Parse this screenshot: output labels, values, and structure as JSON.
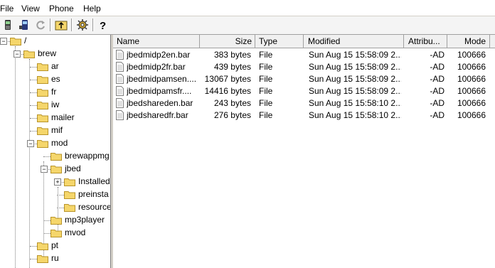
{
  "menu": [
    "File",
    "View",
    "Phone",
    "Help"
  ],
  "toolbar": {
    "icons": [
      "phone-icon",
      "phone-connect-icon",
      "refresh-icon",
      "up-folder-icon",
      "settings-icon",
      "help-icon"
    ]
  },
  "tree": {
    "nodes": [
      {
        "label": "/",
        "expand": "-"
      },
      {
        "label": "brew",
        "expand": "-"
      },
      {
        "label": "ar",
        "expand": ""
      },
      {
        "label": "es",
        "expand": ""
      },
      {
        "label": "fr",
        "expand": ""
      },
      {
        "label": "iw",
        "expand": ""
      },
      {
        "label": "mailer",
        "expand": ""
      },
      {
        "label": "mif",
        "expand": ""
      },
      {
        "label": "mod",
        "expand": "-"
      },
      {
        "label": "brewappmg",
        "expand": ""
      },
      {
        "label": "jbed",
        "expand": "-"
      },
      {
        "label": "Installed",
        "expand": "+"
      },
      {
        "label": "preinsta",
        "expand": ""
      },
      {
        "label": "resource",
        "expand": ""
      },
      {
        "label": "mp3player",
        "expand": ""
      },
      {
        "label": "mvod",
        "expand": ""
      },
      {
        "label": "pt",
        "expand": ""
      },
      {
        "label": "ru",
        "expand": ""
      }
    ]
  },
  "list": {
    "columns": [
      "Name",
      "Size",
      "Type",
      "Modified",
      "Attribu...",
      "Mode"
    ],
    "rows": [
      {
        "name": "jbedmidp2en.bar",
        "size": "383 bytes",
        "type": "File",
        "modified": "Sun Aug 15 15:58:09 2...",
        "attr": "-AD",
        "mode": "100666"
      },
      {
        "name": "jbedmidp2fr.bar",
        "size": "439 bytes",
        "type": "File",
        "modified": "Sun Aug 15 15:58:09 2...",
        "attr": "-AD",
        "mode": "100666"
      },
      {
        "name": "jbedmidpamsen....",
        "size": "13067 bytes",
        "type": "File",
        "modified": "Sun Aug 15 15:58:09 2...",
        "attr": "-AD",
        "mode": "100666"
      },
      {
        "name": "jbedmidpamsfr....",
        "size": "14416 bytes",
        "type": "File",
        "modified": "Sun Aug 15 15:58:09 2...",
        "attr": "-AD",
        "mode": "100666"
      },
      {
        "name": "jbedshareden.bar",
        "size": "243 bytes",
        "type": "File",
        "modified": "Sun Aug 15 15:58:10 2...",
        "attr": "-AD",
        "mode": "100666"
      },
      {
        "name": "jbedsharedfr.bar",
        "size": "276 bytes",
        "type": "File",
        "modified": "Sun Aug 15 15:58:10 2...",
        "attr": "-AD",
        "mode": "100666"
      }
    ]
  },
  "colors": {
    "folder": "#f5d66b",
    "folder_edge": "#b8942a",
    "header_bg": "#f0f0f0"
  }
}
